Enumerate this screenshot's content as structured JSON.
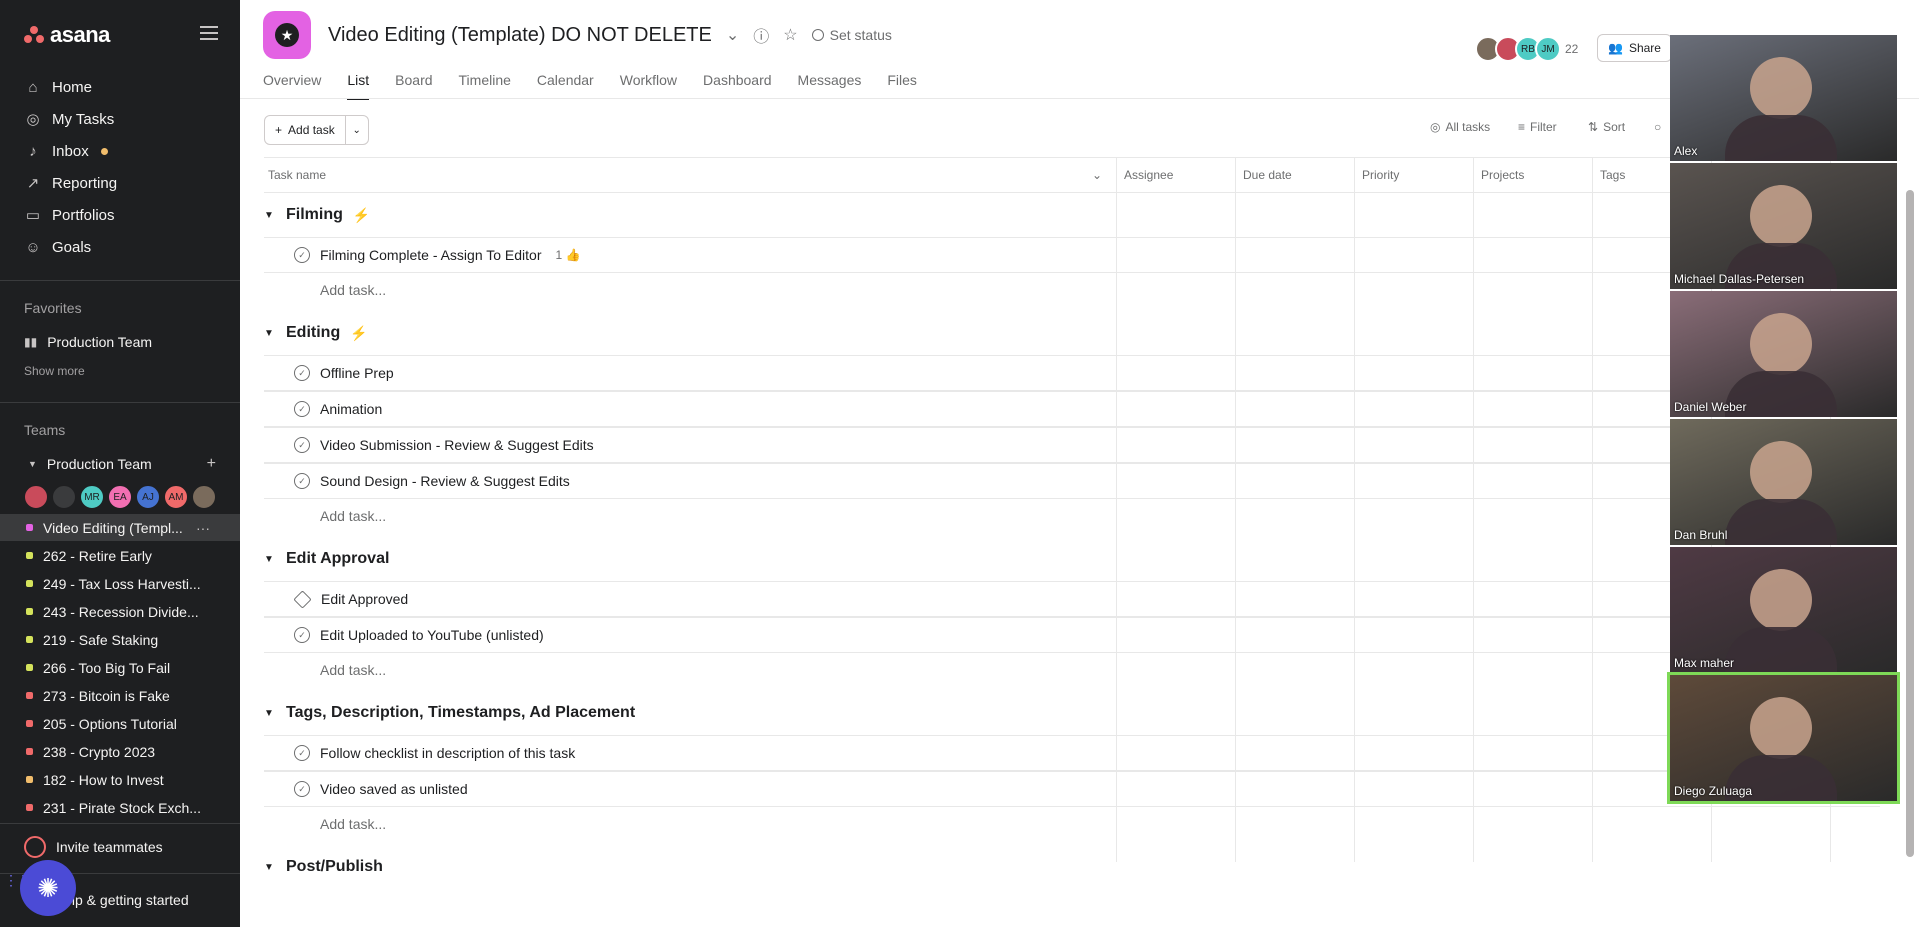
{
  "sidebar": {
    "logo": "asana",
    "nav": [
      {
        "label": "Home",
        "icon": "home-icon"
      },
      {
        "label": "My Tasks",
        "icon": "check-circle-icon"
      },
      {
        "label": "Inbox",
        "icon": "bell-icon"
      },
      {
        "label": "Reporting",
        "icon": "chart-line-icon"
      },
      {
        "label": "Portfolios",
        "icon": "folder-icon"
      },
      {
        "label": "Goals",
        "icon": "person-icon"
      }
    ],
    "favorites_label": "Favorites",
    "favorite_item": "Production Team",
    "show_more": "Show more",
    "teams_label": "Teams",
    "team_name": "Production Team",
    "team_avatars": [
      "",
      "",
      "MR",
      "EA",
      "AJ",
      "AM",
      ""
    ],
    "projects": [
      {
        "label": "Video Editing (Templ...",
        "color": "#e362e3"
      },
      {
        "label": "262 - Retire Early",
        "color": "#d5e35c"
      },
      {
        "label": "249 - Tax Loss Harvesti...",
        "color": "#d5e35c"
      },
      {
        "label": "243 - Recession Divide...",
        "color": "#d5e35c"
      },
      {
        "label": "219 - Safe Staking",
        "color": "#d5e35c"
      },
      {
        "label": "266 - Too Big To Fail",
        "color": "#d5e35c"
      },
      {
        "label": "273 - Bitcoin is Fake",
        "color": "#f06a6a"
      },
      {
        "label": "205 - Options Tutorial",
        "color": "#f06a6a"
      },
      {
        "label": "238 - Crypto 2023",
        "color": "#f06a6a"
      },
      {
        "label": "182 - How to Invest",
        "color": "#f1bd6c"
      },
      {
        "label": "231 - Pirate Stock Exch...",
        "color": "#f06a6a"
      }
    ],
    "invite": "Invite teammates",
    "help": "Help & getting started"
  },
  "header": {
    "title": "Video Editing (Template) DO NOT DELETE",
    "set_status": "Set status",
    "tabs": [
      "Overview",
      "List",
      "Board",
      "Timeline",
      "Calendar",
      "Workflow",
      "Dashboard",
      "Messages",
      "Files"
    ],
    "active_tab": "List",
    "members": [
      "",
      "",
      "RB",
      "JM"
    ],
    "member_count": "22",
    "share": "Share"
  },
  "toolbar": {
    "add_task": "Add task",
    "all_tasks": "All tasks",
    "filter": "Filter",
    "sort": "Sort"
  },
  "columns": [
    "Task name",
    "Assignee",
    "Due date",
    "Priority",
    "Projects",
    "Tags"
  ],
  "add_task_link": "Add task...",
  "sections": [
    {
      "name": "Filming",
      "bolt": true,
      "tasks": [
        {
          "name": "Filming Complete - Assign To Editor",
          "likes": "1"
        }
      ]
    },
    {
      "name": "Editing",
      "bolt": true,
      "tasks": [
        {
          "name": "Offline Prep"
        },
        {
          "name": "Animation"
        },
        {
          "name": "Video Submission - Review & Suggest Edits"
        },
        {
          "name": "Sound Design - Review & Suggest Edits"
        }
      ]
    },
    {
      "name": "Edit Approval",
      "bolt": false,
      "tasks": [
        {
          "name": "Edit Approved",
          "milestone": true
        },
        {
          "name": "Edit Uploaded to YouTube (unlisted)"
        }
      ]
    },
    {
      "name": "Tags, Description, Timestamps, Ad Placement",
      "bolt": false,
      "tasks": [
        {
          "name": "Follow checklist in description of this task"
        },
        {
          "name": "Video saved as unlisted"
        }
      ]
    },
    {
      "name": "Post/Publish",
      "bolt": false,
      "tasks": []
    }
  ],
  "video_call": [
    {
      "name": "Alex",
      "bg": "#6b6f7a",
      "active": false
    },
    {
      "name": "Michael Dallas-Petersen",
      "bg": "#5a5450",
      "active": false
    },
    {
      "name": "Daniel Weber",
      "bg": "#8a6d78",
      "active": false
    },
    {
      "name": "Dan Bruhl",
      "bg": "#6f6a5c",
      "active": false
    },
    {
      "name": "Max maher",
      "bg": "#4f3a44",
      "active": false
    },
    {
      "name": "Diego Zuluaga",
      "bg": "#5e4a3a",
      "active": true
    }
  ]
}
